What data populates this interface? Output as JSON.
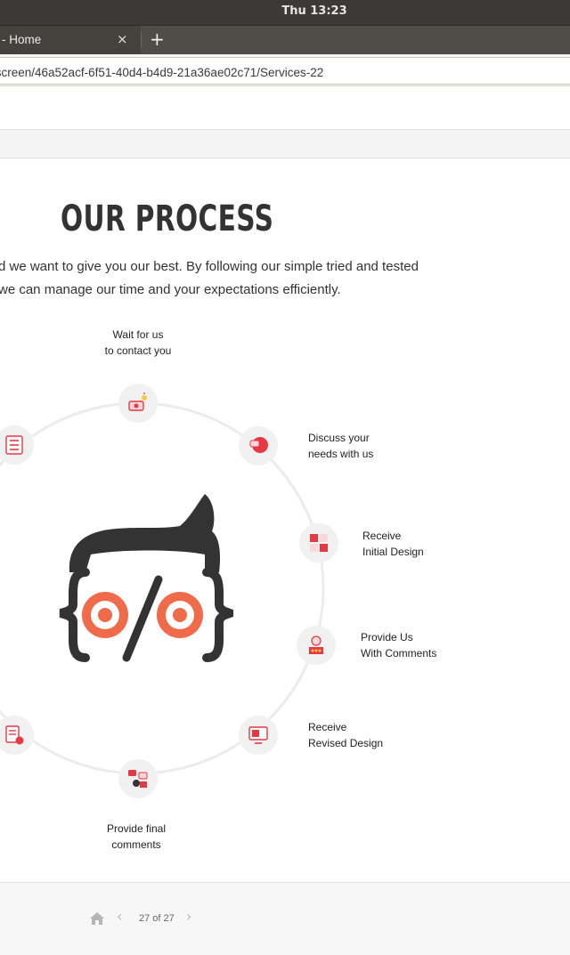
{
  "system": {
    "clock": "Thu 13:23"
  },
  "browser": {
    "tab_title": "- Home",
    "tab_close": "×",
    "new_tab": "+",
    "url": "/screen/46a52acf-6f51-40d4-b4d9-21a36ae02c71/Services-22"
  },
  "page": {
    "title": "OUR PROCESS",
    "intro_line1": "d we want to give you our best. By following our simple tried and tested",
    "intro_line2": " we can manage our time and your expectations efficiently."
  },
  "steps": [
    {
      "line1": "Wait for us",
      "line2": "to contact you",
      "icon": "contact-tag-icon"
    },
    {
      "line1": "Discuss your",
      "line2": "needs with us",
      "icon": "discuss-head-icon"
    },
    {
      "line1": "Receive",
      "line2": "Initial Design",
      "icon": "puzzle-icon"
    },
    {
      "line1": "Provide Us",
      "line2": "With Comments",
      "icon": "person-rating-icon"
    },
    {
      "line1": "Receive",
      "line2": "Revised Design",
      "icon": "monitor-design-icon"
    },
    {
      "line1": "Provide final",
      "line2": "comments",
      "icon": "feedback-chat-icon"
    }
  ],
  "colors": {
    "accent": "#e63946",
    "logo_dark": "#333333",
    "logo_orange": "#ef6b4a"
  },
  "footer": {
    "prev": "‹",
    "page_count": "27 of 27",
    "next": "›"
  }
}
